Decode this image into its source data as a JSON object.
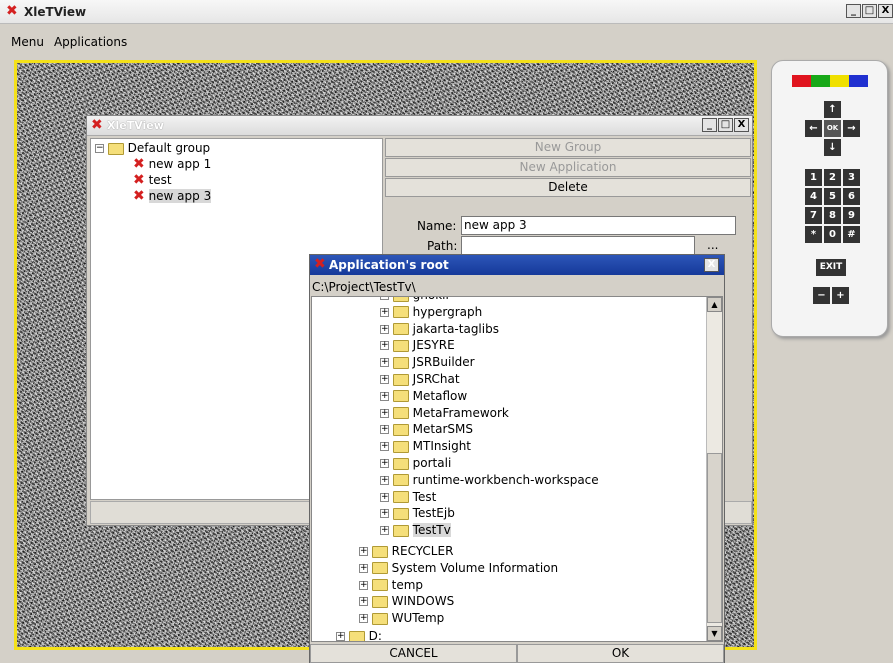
{
  "window": {
    "title": "XleTView",
    "buttons": [
      "_",
      "□",
      "X"
    ]
  },
  "menu": {
    "items": [
      "Menu",
      "Applications"
    ]
  },
  "manager": {
    "title": "XleTView",
    "tree": {
      "group": "Default group",
      "apps": [
        "new app 1",
        "test",
        "new app 3"
      ]
    },
    "buttons": {
      "new_group": "New Group",
      "new_application": "New Application",
      "delete": "Delete"
    },
    "form": {
      "name_label": "Name:",
      "name_value": "new app 3",
      "path_label": "Path:",
      "path_value": "",
      "browse": "..."
    }
  },
  "dialog": {
    "title": "Application's root",
    "close": "X",
    "path": "C:\\Project\\TestTv\\",
    "folders_project": [
      "gnokii",
      "hypergraph",
      "jakarta-taglibs",
      "JESYRE",
      "JSRBuilder",
      "JSRChat",
      "Metaflow",
      "MetaFramework",
      "MetarSMS",
      "MTInsight",
      "portali",
      "runtime-workbench-workspace",
      "Test",
      "TestEjb",
      "TestTv"
    ],
    "folders_root": [
      "RECYCLER",
      "System Volume Information",
      "temp",
      "WINDOWS",
      "WUTemp"
    ],
    "drive": "D:",
    "cancel": "CANCEL",
    "ok": "OK"
  },
  "remote": {
    "colors": [
      "#e0141e",
      "#18a818",
      "#f0e000",
      "#2030d0"
    ],
    "arrows": {
      "up": "↑",
      "left": "←",
      "ok": "OK",
      "right": "→",
      "down": "↓"
    },
    "keys": [
      "1",
      "2",
      "3",
      "4",
      "5",
      "6",
      "7",
      "8",
      "9",
      "*",
      "0",
      "#"
    ],
    "exit": "EXIT",
    "minus": "−",
    "plus": "+"
  }
}
